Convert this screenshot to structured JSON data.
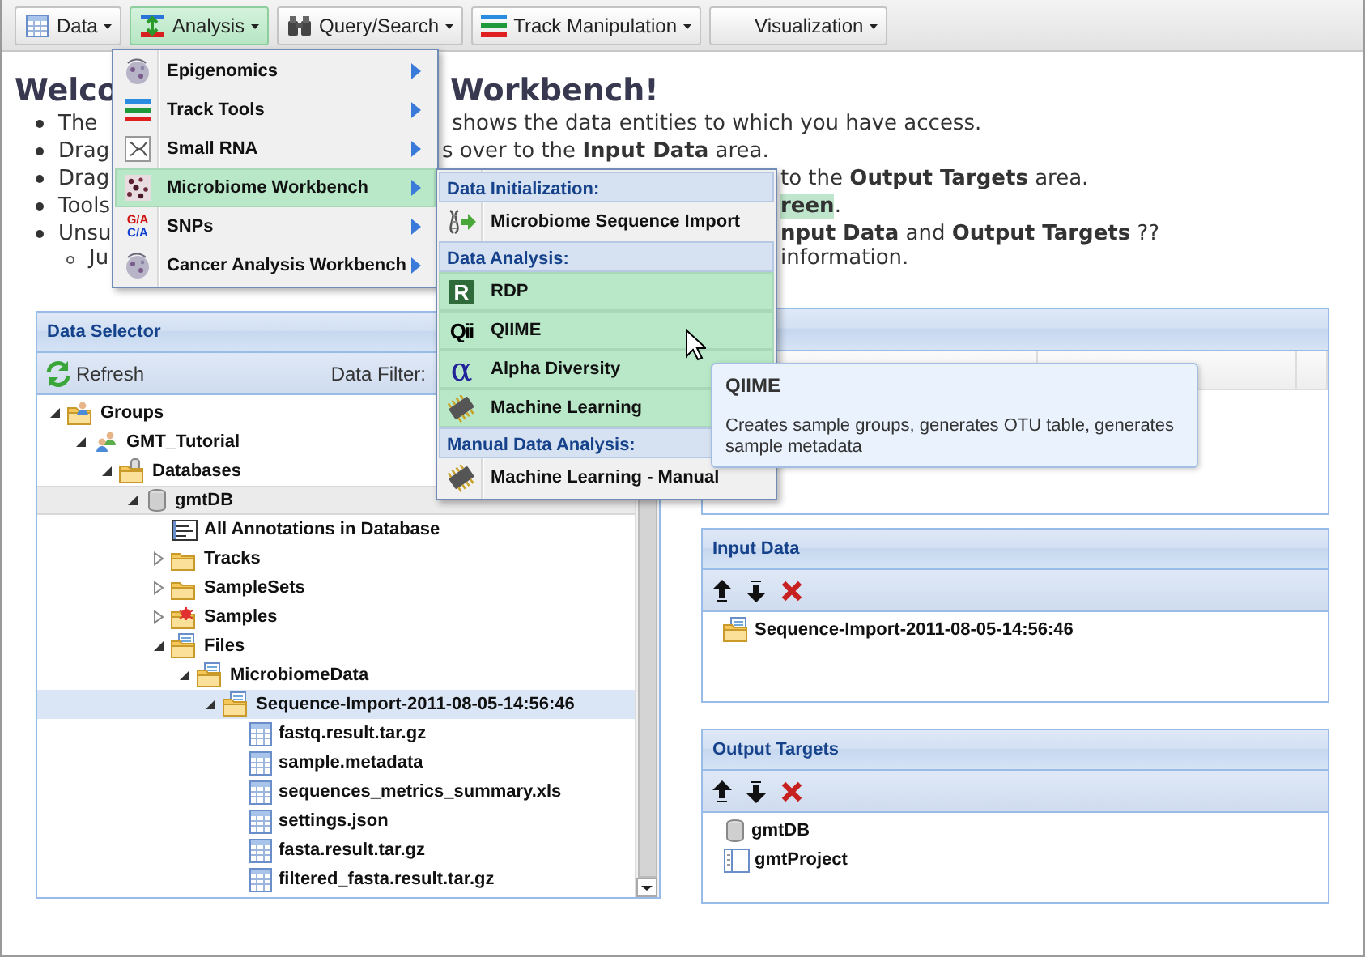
{
  "toolbar": [
    {
      "label": "Data",
      "selected": false
    },
    {
      "label": "Analysis",
      "selected": true
    },
    {
      "label": "Query/Search",
      "selected": false
    },
    {
      "label": "Track Manipulation",
      "selected": false
    },
    {
      "label": "Visualization",
      "selected": false
    }
  ],
  "welcome": {
    "heading": {
      "start": "Welco",
      "end": "Workbench!"
    },
    "bullets": [
      {
        "start": "The",
        "end": "shows the data entities to which you have access."
      },
      {
        "start": "Drag",
        "end": "s over to the **Input Data** area."
      },
      {
        "start": "Drag",
        "end": "to the **Output Targets** area."
      },
      {
        "start": "Tools",
        "end": "**reen**."
      },
      {
        "start": "Unsu",
        "end": "**nput Data** and **Output Targets** ??",
        "children": [
          {
            "start": "Ju",
            "end": "information."
          }
        ]
      }
    ]
  },
  "data_selector": {
    "title": "Data Selector",
    "refresh": "Refresh",
    "filter_label": "Data Filter:",
    "tree": [
      {
        "label": "Groups",
        "kind": "group-folder",
        "expanded": true,
        "selected": false,
        "highlighted": false,
        "children": [
          {
            "label": "GMT_Tutorial",
            "kind": "group",
            "expanded": true,
            "selected": false,
            "highlighted": false,
            "children": [
              {
                "label": "Databases",
                "kind": "database-folder",
                "expanded": true,
                "selected": false,
                "highlighted": false,
                "children": [
                  {
                    "label": "gmtDB",
                    "kind": "database",
                    "expanded": true,
                    "selected": false,
                    "highlighted": true,
                    "children": [
                      {
                        "label": "All Annotations in Database",
                        "kind": "annotations",
                        "selected": false,
                        "highlighted": false
                      },
                      {
                        "label": "Tracks",
                        "kind": "folder",
                        "expanded": false,
                        "selected": false,
                        "highlighted": false
                      },
                      {
                        "label": "SampleSets",
                        "kind": "folder",
                        "expanded": false,
                        "selected": false,
                        "highlighted": false
                      },
                      {
                        "label": "Samples",
                        "kind": "sample-folder",
                        "expanded": false,
                        "selected": false,
                        "highlighted": false
                      },
                      {
                        "label": "Files",
                        "kind": "files-folder",
                        "expanded": true,
                        "selected": false,
                        "highlighted": false,
                        "children": [
                          {
                            "label": "MicrobiomeData",
                            "kind": "files-folder",
                            "expanded": true,
                            "selected": false,
                            "highlighted": false,
                            "children": [
                              {
                                "label": "Sequence-Import-2011-08-05-14:56:46",
                                "kind": "files-folder",
                                "expanded": true,
                                "selected": true,
                                "highlighted": false,
                                "children": [
                                  {
                                    "label": "fastq.result.tar.gz",
                                    "kind": "file",
                                    "selected": false,
                                    "highlighted": false
                                  },
                                  {
                                    "label": "sample.metadata",
                                    "kind": "file",
                                    "selected": false,
                                    "highlighted": false
                                  },
                                  {
                                    "label": "sequences_metrics_summary.xls",
                                    "kind": "file",
                                    "selected": false,
                                    "highlighted": false
                                  },
                                  {
                                    "label": "settings.json",
                                    "kind": "file",
                                    "selected": false,
                                    "highlighted": false
                                  },
                                  {
                                    "label": "fasta.result.tar.gz",
                                    "kind": "file",
                                    "selected": false,
                                    "highlighted": false
                                  },
                                  {
                                    "label": "filtered_fasta.result.tar.gz",
                                    "kind": "file",
                                    "selected": false,
                                    "highlighted": false
                                  }
                                ]
                              }
                            ]
                          }
                        ]
                      }
                    ]
                  }
                ]
              }
            ]
          }
        ]
      }
    ]
  },
  "input_data": {
    "title": "Input Data",
    "items": [
      {
        "label": "Sequence-Import-2011-08-05-14:56:46",
        "kind": "files-folder"
      }
    ]
  },
  "output_targets": {
    "title": "Output Targets",
    "items": [
      {
        "label": "gmtDB",
        "kind": "database"
      },
      {
        "label": "gmtProject",
        "kind": "project"
      }
    ]
  },
  "analysis_menu": {
    "items": [
      {
        "label": "Epigenomics",
        "selected": false
      },
      {
        "label": "Track Tools",
        "selected": false
      },
      {
        "label": "Small RNA",
        "selected": false
      },
      {
        "label": "Microbiome Workbench",
        "selected": true
      },
      {
        "label": "SNPs",
        "selected": false,
        "icon_text": [
          "G/A",
          "C/A"
        ]
      },
      {
        "label": "Cancer Analysis Workbench",
        "selected": false
      }
    ]
  },
  "microbiome_submenu": {
    "entries": [
      {
        "kind": "header",
        "label": "Data Initialization:"
      },
      {
        "kind": "item",
        "label": "Microbiome Sequence Import",
        "highlighted": false
      },
      {
        "kind": "header",
        "label": "Data Analysis:"
      },
      {
        "kind": "item",
        "label": "RDP",
        "highlighted": true,
        "icon_text": [
          "R"
        ]
      },
      {
        "kind": "item",
        "label": "QIIME",
        "highlighted": true,
        "icon_text": [
          "Qii"
        ]
      },
      {
        "kind": "item",
        "label": "Alpha Diversity",
        "highlighted": true,
        "icon_text": [
          "α"
        ]
      },
      {
        "kind": "item",
        "label": "Machine Learning",
        "highlighted": true
      },
      {
        "kind": "header",
        "label": "Manual Data Analysis:"
      },
      {
        "kind": "item",
        "label": "Machine Learning - Manual",
        "highlighted": false
      }
    ]
  },
  "tooltip": {
    "title": "QIIME",
    "text": "Creates sample groups, generates OTU table, generates sample metadata"
  }
}
